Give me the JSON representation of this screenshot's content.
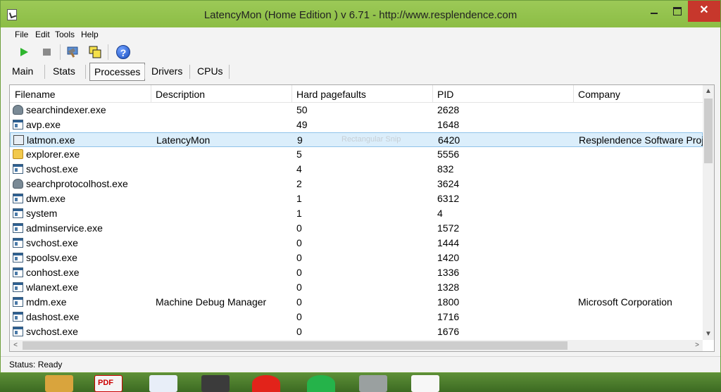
{
  "window": {
    "title": "LatencyMon  (Home Edition )  v 6.71 - http://www.resplendence.com",
    "controls": {
      "minimize": "",
      "maximize": "",
      "close": "✕"
    }
  },
  "menu": {
    "items": [
      {
        "label": "File",
        "accel": "F"
      },
      {
        "label": "Edit",
        "accel": "E"
      },
      {
        "label": "Tools",
        "accel": "T"
      },
      {
        "label": "Help",
        "accel": "H"
      }
    ]
  },
  "toolbar": {
    "icons": [
      "play-icon",
      "stop-icon",
      "hammer-icon",
      "windows-icon",
      "help-icon"
    ],
    "help_glyph": "?"
  },
  "tabs": [
    {
      "label": "Main",
      "active": false
    },
    {
      "label": "Stats",
      "active": false
    },
    {
      "label": "Processes",
      "active": true
    },
    {
      "label": "Drivers",
      "active": false
    },
    {
      "label": "CPUs",
      "active": false
    }
  ],
  "table": {
    "columns": [
      "Filename",
      "Description",
      "Hard pagefaults",
      "PID",
      "Company"
    ],
    "rows": [
      {
        "icon": "user",
        "filename": "searchindexer.exe",
        "description": "",
        "pagefaults": "50",
        "pid": "2628",
        "company": ""
      },
      {
        "icon": "exe",
        "filename": "avp.exe",
        "description": "",
        "pagefaults": "49",
        "pid": "1648",
        "company": ""
      },
      {
        "icon": "latmon",
        "filename": "latmon.exe",
        "description": "LatencyMon",
        "pagefaults": "9",
        "pid": "6420",
        "company": "Resplendence Software Proj...",
        "selected": true
      },
      {
        "icon": "folder",
        "filename": "explorer.exe",
        "description": "",
        "pagefaults": "5",
        "pid": "5556",
        "company": ""
      },
      {
        "icon": "exe",
        "filename": "svchost.exe",
        "description": "",
        "pagefaults": "4",
        "pid": "832",
        "company": ""
      },
      {
        "icon": "user",
        "filename": "searchprotocolhost.exe",
        "description": "",
        "pagefaults": "2",
        "pid": "3624",
        "company": ""
      },
      {
        "icon": "exe",
        "filename": "dwm.exe",
        "description": "",
        "pagefaults": "1",
        "pid": "6312",
        "company": ""
      },
      {
        "icon": "exe",
        "filename": "system",
        "description": "",
        "pagefaults": "1",
        "pid": "4",
        "company": ""
      },
      {
        "icon": "exe",
        "filename": "adminservice.exe",
        "description": "",
        "pagefaults": "0",
        "pid": "1572",
        "company": ""
      },
      {
        "icon": "exe",
        "filename": "svchost.exe",
        "description": "",
        "pagefaults": "0",
        "pid": "1444",
        "company": ""
      },
      {
        "icon": "exe",
        "filename": "spoolsv.exe",
        "description": "",
        "pagefaults": "0",
        "pid": "1420",
        "company": ""
      },
      {
        "icon": "exe",
        "filename": "conhost.exe",
        "description": "",
        "pagefaults": "0",
        "pid": "1336",
        "company": ""
      },
      {
        "icon": "exe",
        "filename": "wlanext.exe",
        "description": "",
        "pagefaults": "0",
        "pid": "1328",
        "company": ""
      },
      {
        "icon": "exe",
        "filename": "mdm.exe",
        "description": "Machine Debug Manager",
        "pagefaults": "0",
        "pid": "1800",
        "company": "Microsoft Corporation"
      },
      {
        "icon": "exe",
        "filename": "dashost.exe",
        "description": "",
        "pagefaults": "0",
        "pid": "1716",
        "company": ""
      },
      {
        "icon": "exe",
        "filename": "svchost.exe",
        "description": "",
        "pagefaults": "0",
        "pid": "1676",
        "company": ""
      }
    ],
    "snip_ghost": "Rectangular Snip"
  },
  "scroll": {
    "up": "▲",
    "down": "▼",
    "left": "<",
    "right": ">"
  },
  "status": "Status: Ready",
  "taskbar": {
    "apps": [
      "folder-app",
      "pdf-app",
      "word-app",
      "evernote-app",
      "vodafone-app",
      "whatsapp-app",
      "photo-app",
      "document-app"
    ],
    "pdf_label": "PDF"
  },
  "colors": {
    "titlebar": "#8cbd45",
    "close_button": "#c7372c",
    "selection": "#dbeefb"
  }
}
